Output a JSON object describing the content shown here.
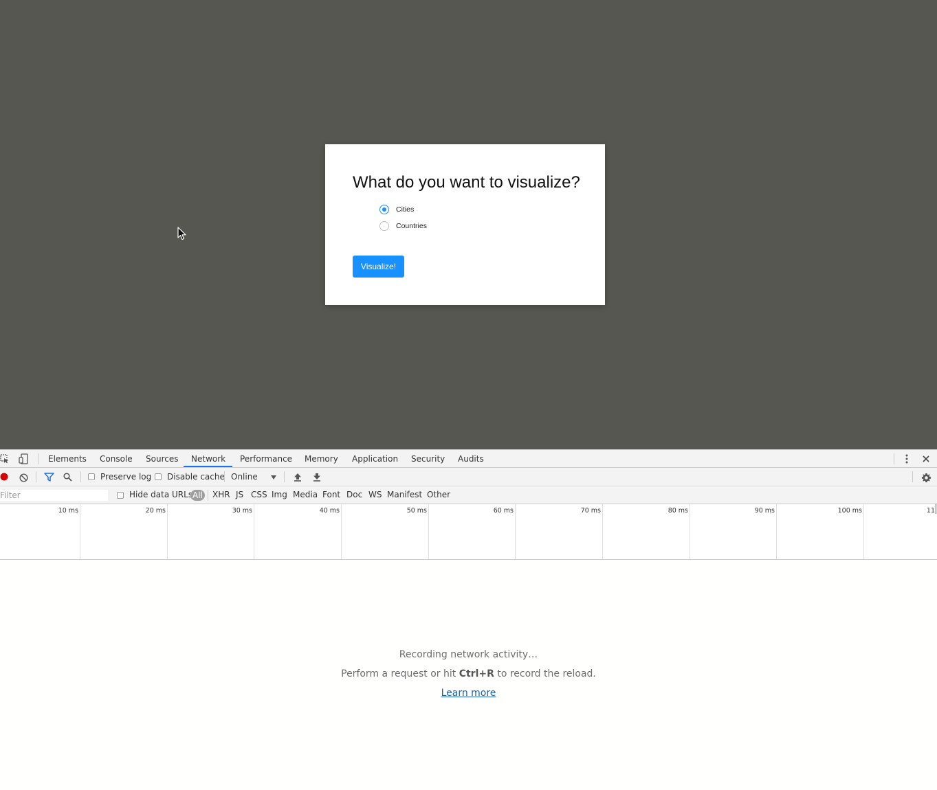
{
  "dialog": {
    "title": "What do you want to visualize?",
    "options": [
      {
        "label": "Cities",
        "checked": true
      },
      {
        "label": "Countries",
        "checked": false
      }
    ],
    "submit_label": "Visualize!",
    "accent_color": "#1890ff"
  },
  "devtools": {
    "tabs": [
      "Elements",
      "Console",
      "Sources",
      "Network",
      "Performance",
      "Memory",
      "Application",
      "Security",
      "Audits"
    ],
    "active_tab": "Network",
    "toolbar": {
      "preserve_log": "Preserve log",
      "disable_cache": "Disable cache",
      "throttling": "Online"
    },
    "filter": {
      "placeholder": "Filter",
      "hide_data_urls": "Hide data URLs",
      "types": [
        "All",
        "XHR",
        "JS",
        "CSS",
        "Img",
        "Media",
        "Font",
        "Doc",
        "WS",
        "Manifest",
        "Other"
      ]
    },
    "timeline_ticks": [
      "10 ms",
      "20 ms",
      "30 ms",
      "40 ms",
      "50 ms",
      "60 ms",
      "70 ms",
      "80 ms",
      "90 ms",
      "100 ms",
      "11"
    ],
    "empty_state": {
      "recording": "Recording network activity…",
      "hint_before": "Perform a request or hit ",
      "hint_key": "Ctrl+R",
      "hint_after": " to record the reload.",
      "learn_more": "Learn more"
    }
  }
}
